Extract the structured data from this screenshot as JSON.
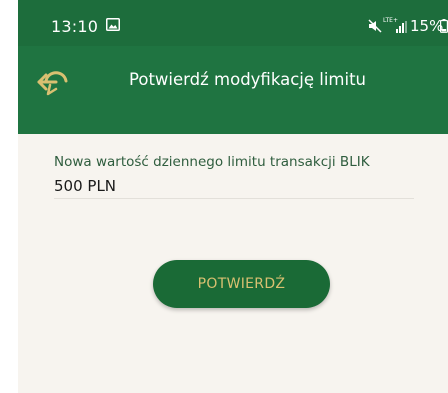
{
  "status_bar": {
    "time": "13:10",
    "network": "LTE+",
    "battery_percent": "15%",
    "icons": [
      "gallery-icon",
      "mute-icon",
      "signal-icon",
      "battery-icon"
    ]
  },
  "header": {
    "title": "Potwierdź modyfikację limitu",
    "back_icon": "back-arrow-icon"
  },
  "form": {
    "label": "Nowa wartość dziennego limitu transakcji BLIK",
    "value": "500 PLN"
  },
  "actions": {
    "confirm_label": "POTWIERDŹ"
  },
  "colors": {
    "status_bar": "#1d6d3c",
    "header": "#1f7441",
    "background": "#f7f4ef",
    "accent_gold": "#d9c071",
    "button": "#1a6a36"
  }
}
